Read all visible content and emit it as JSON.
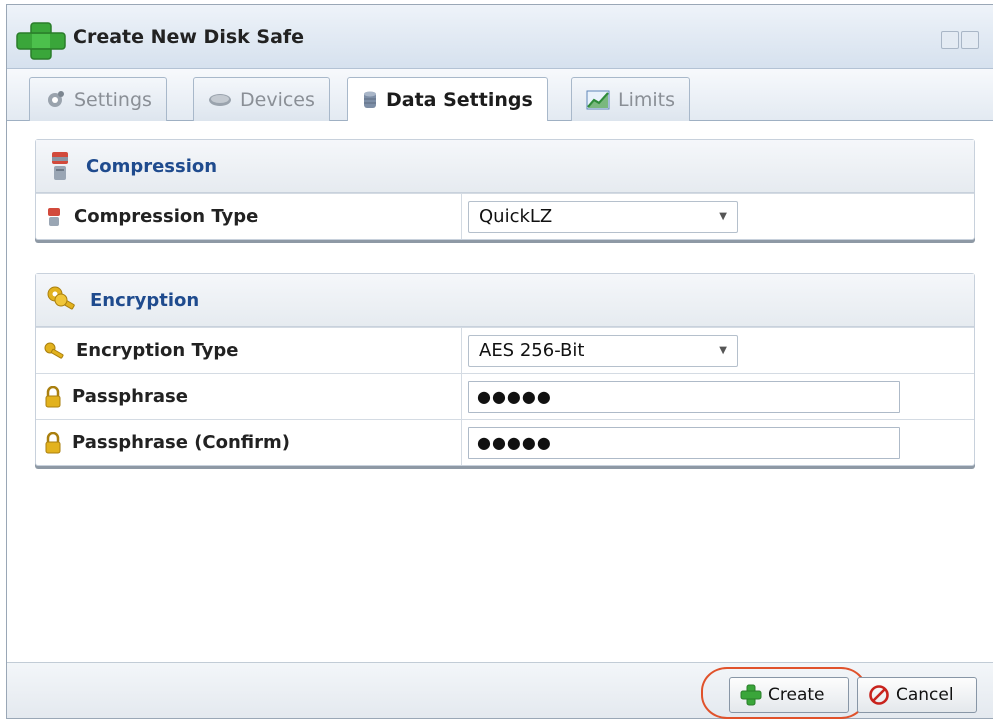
{
  "dialog": {
    "title": "Create New Disk Safe"
  },
  "tabs": [
    {
      "label": "Settings",
      "icon": "gear-icon",
      "active": false
    },
    {
      "label": "Devices",
      "icon": "disk-icon",
      "active": false
    },
    {
      "label": "Data Settings",
      "icon": "database-icon",
      "active": true
    },
    {
      "label": "Limits",
      "icon": "chart-icon",
      "active": false
    }
  ],
  "compression": {
    "header": "Compression",
    "type_label": "Compression Type",
    "type_value": "QuickLZ"
  },
  "encryption": {
    "header": "Encryption",
    "type_label": "Encryption Type",
    "type_value": "AES 256-Bit",
    "passphrase_label": "Passphrase",
    "passphrase_value": "●●●●●",
    "confirm_label": "Passphrase (Confirm)",
    "confirm_value": "●●●●●"
  },
  "footer": {
    "create_label": "Create",
    "cancel_label": "Cancel"
  },
  "colors": {
    "accent": "#1f4b8e",
    "highlight": "#e0522b",
    "plus_green": "#3aa63a"
  }
}
